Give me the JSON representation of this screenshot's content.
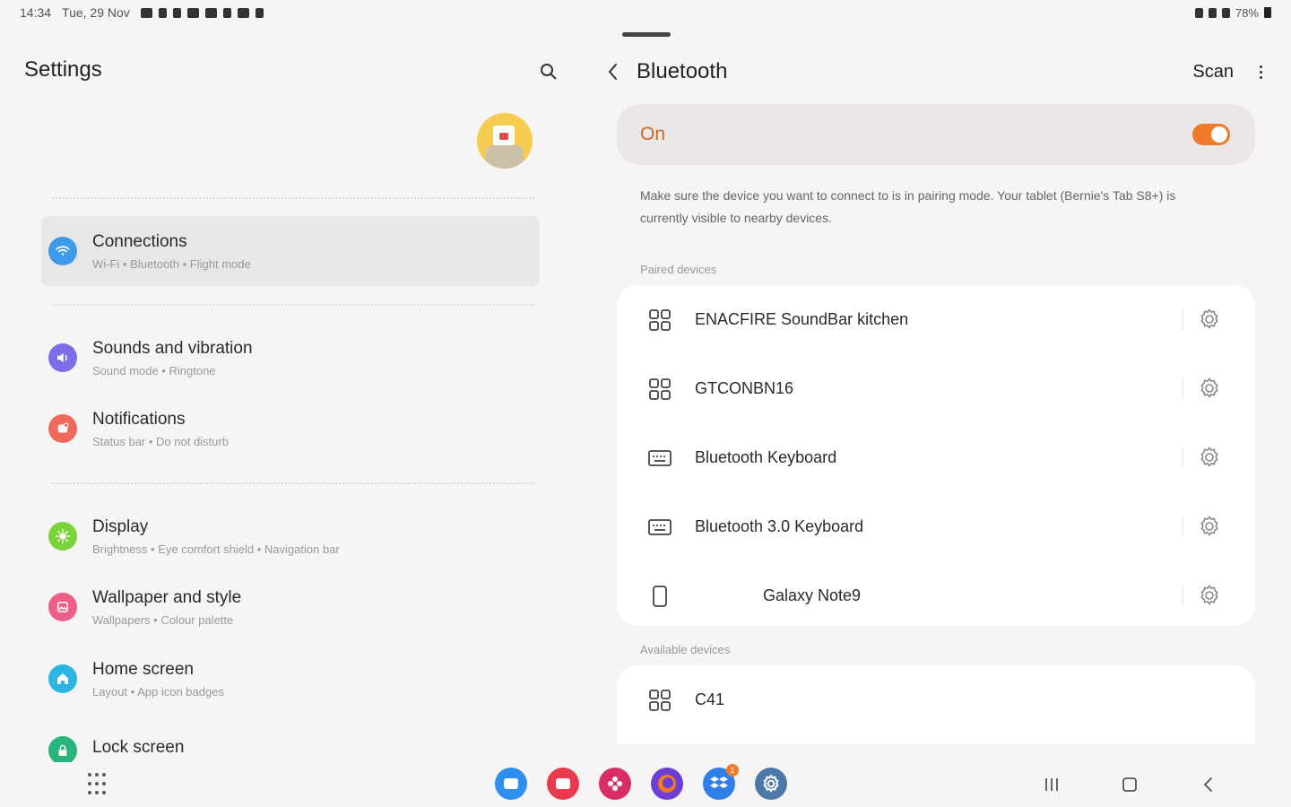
{
  "status_bar": {
    "time": "14:34",
    "date": "Tue, 29 Nov",
    "battery": "78%"
  },
  "settings": {
    "title": "Settings",
    "items": [
      {
        "title": "Connections",
        "subtitle": "Wi-Fi  •  Bluetooth  •  Flight mode",
        "color": "#3d9be9",
        "icon": "wifi-icon"
      },
      {
        "title": "Sounds and vibration",
        "subtitle": "Sound mode  •  Ringtone",
        "color": "#7b6ee8",
        "icon": "volume-icon"
      },
      {
        "title": "Notifications",
        "subtitle": "Status bar  •  Do not disturb",
        "color": "#ef6a5a",
        "icon": "notification-icon"
      },
      {
        "title": "Display",
        "subtitle": "Brightness  •  Eye comfort shield  •  Navigation bar",
        "color": "#7cd23a",
        "icon": "sun-icon"
      },
      {
        "title": "Wallpaper and style",
        "subtitle": "Wallpapers  •  Colour palette",
        "color": "#ec5f86",
        "icon": "wallpaper-icon"
      },
      {
        "title": "Home screen",
        "subtitle": "Layout  •  App icon badges",
        "color": "#2bb5e0",
        "icon": "home-icon"
      },
      {
        "title": "Lock screen",
        "subtitle": "",
        "color": "#27b57b",
        "icon": "lock-icon"
      }
    ]
  },
  "bluetooth": {
    "title": "Bluetooth",
    "scan_label": "Scan",
    "on_label": "On",
    "description": "Make sure the device you want to connect to is in pairing mode. Your tablet (Bernie's Tab S8+) is currently visible to nearby devices.",
    "paired_label": "Paired devices",
    "available_label": "Available devices",
    "paired_devices": [
      {
        "name": "ENACFIRE SoundBar  kitchen",
        "icon": "generic-device-icon"
      },
      {
        "name": "GTCONBN16",
        "icon": "generic-device-icon"
      },
      {
        "name": "Bluetooth Keyboard",
        "icon": "keyboard-icon"
      },
      {
        "name": "Bluetooth 3.0 Keyboard",
        "icon": "keyboard-icon"
      },
      {
        "name": "Galaxy Note9",
        "icon": "phone-icon"
      }
    ],
    "available_devices": [
      {
        "name": "C41",
        "icon": "generic-device-icon"
      }
    ]
  },
  "dock": {
    "apps": [
      {
        "name": "messages-app",
        "color": "#2d8ff0"
      },
      {
        "name": "screen-recorder-app",
        "color": "#e83b4d"
      },
      {
        "name": "flower-app",
        "color": "#d92d6a"
      },
      {
        "name": "firefox-app",
        "color": "#6b3ed6"
      },
      {
        "name": "dropbox-app",
        "color": "#2e7fe8",
        "badge": "1"
      },
      {
        "name": "settings-app",
        "color": "#4c79a8"
      }
    ]
  }
}
